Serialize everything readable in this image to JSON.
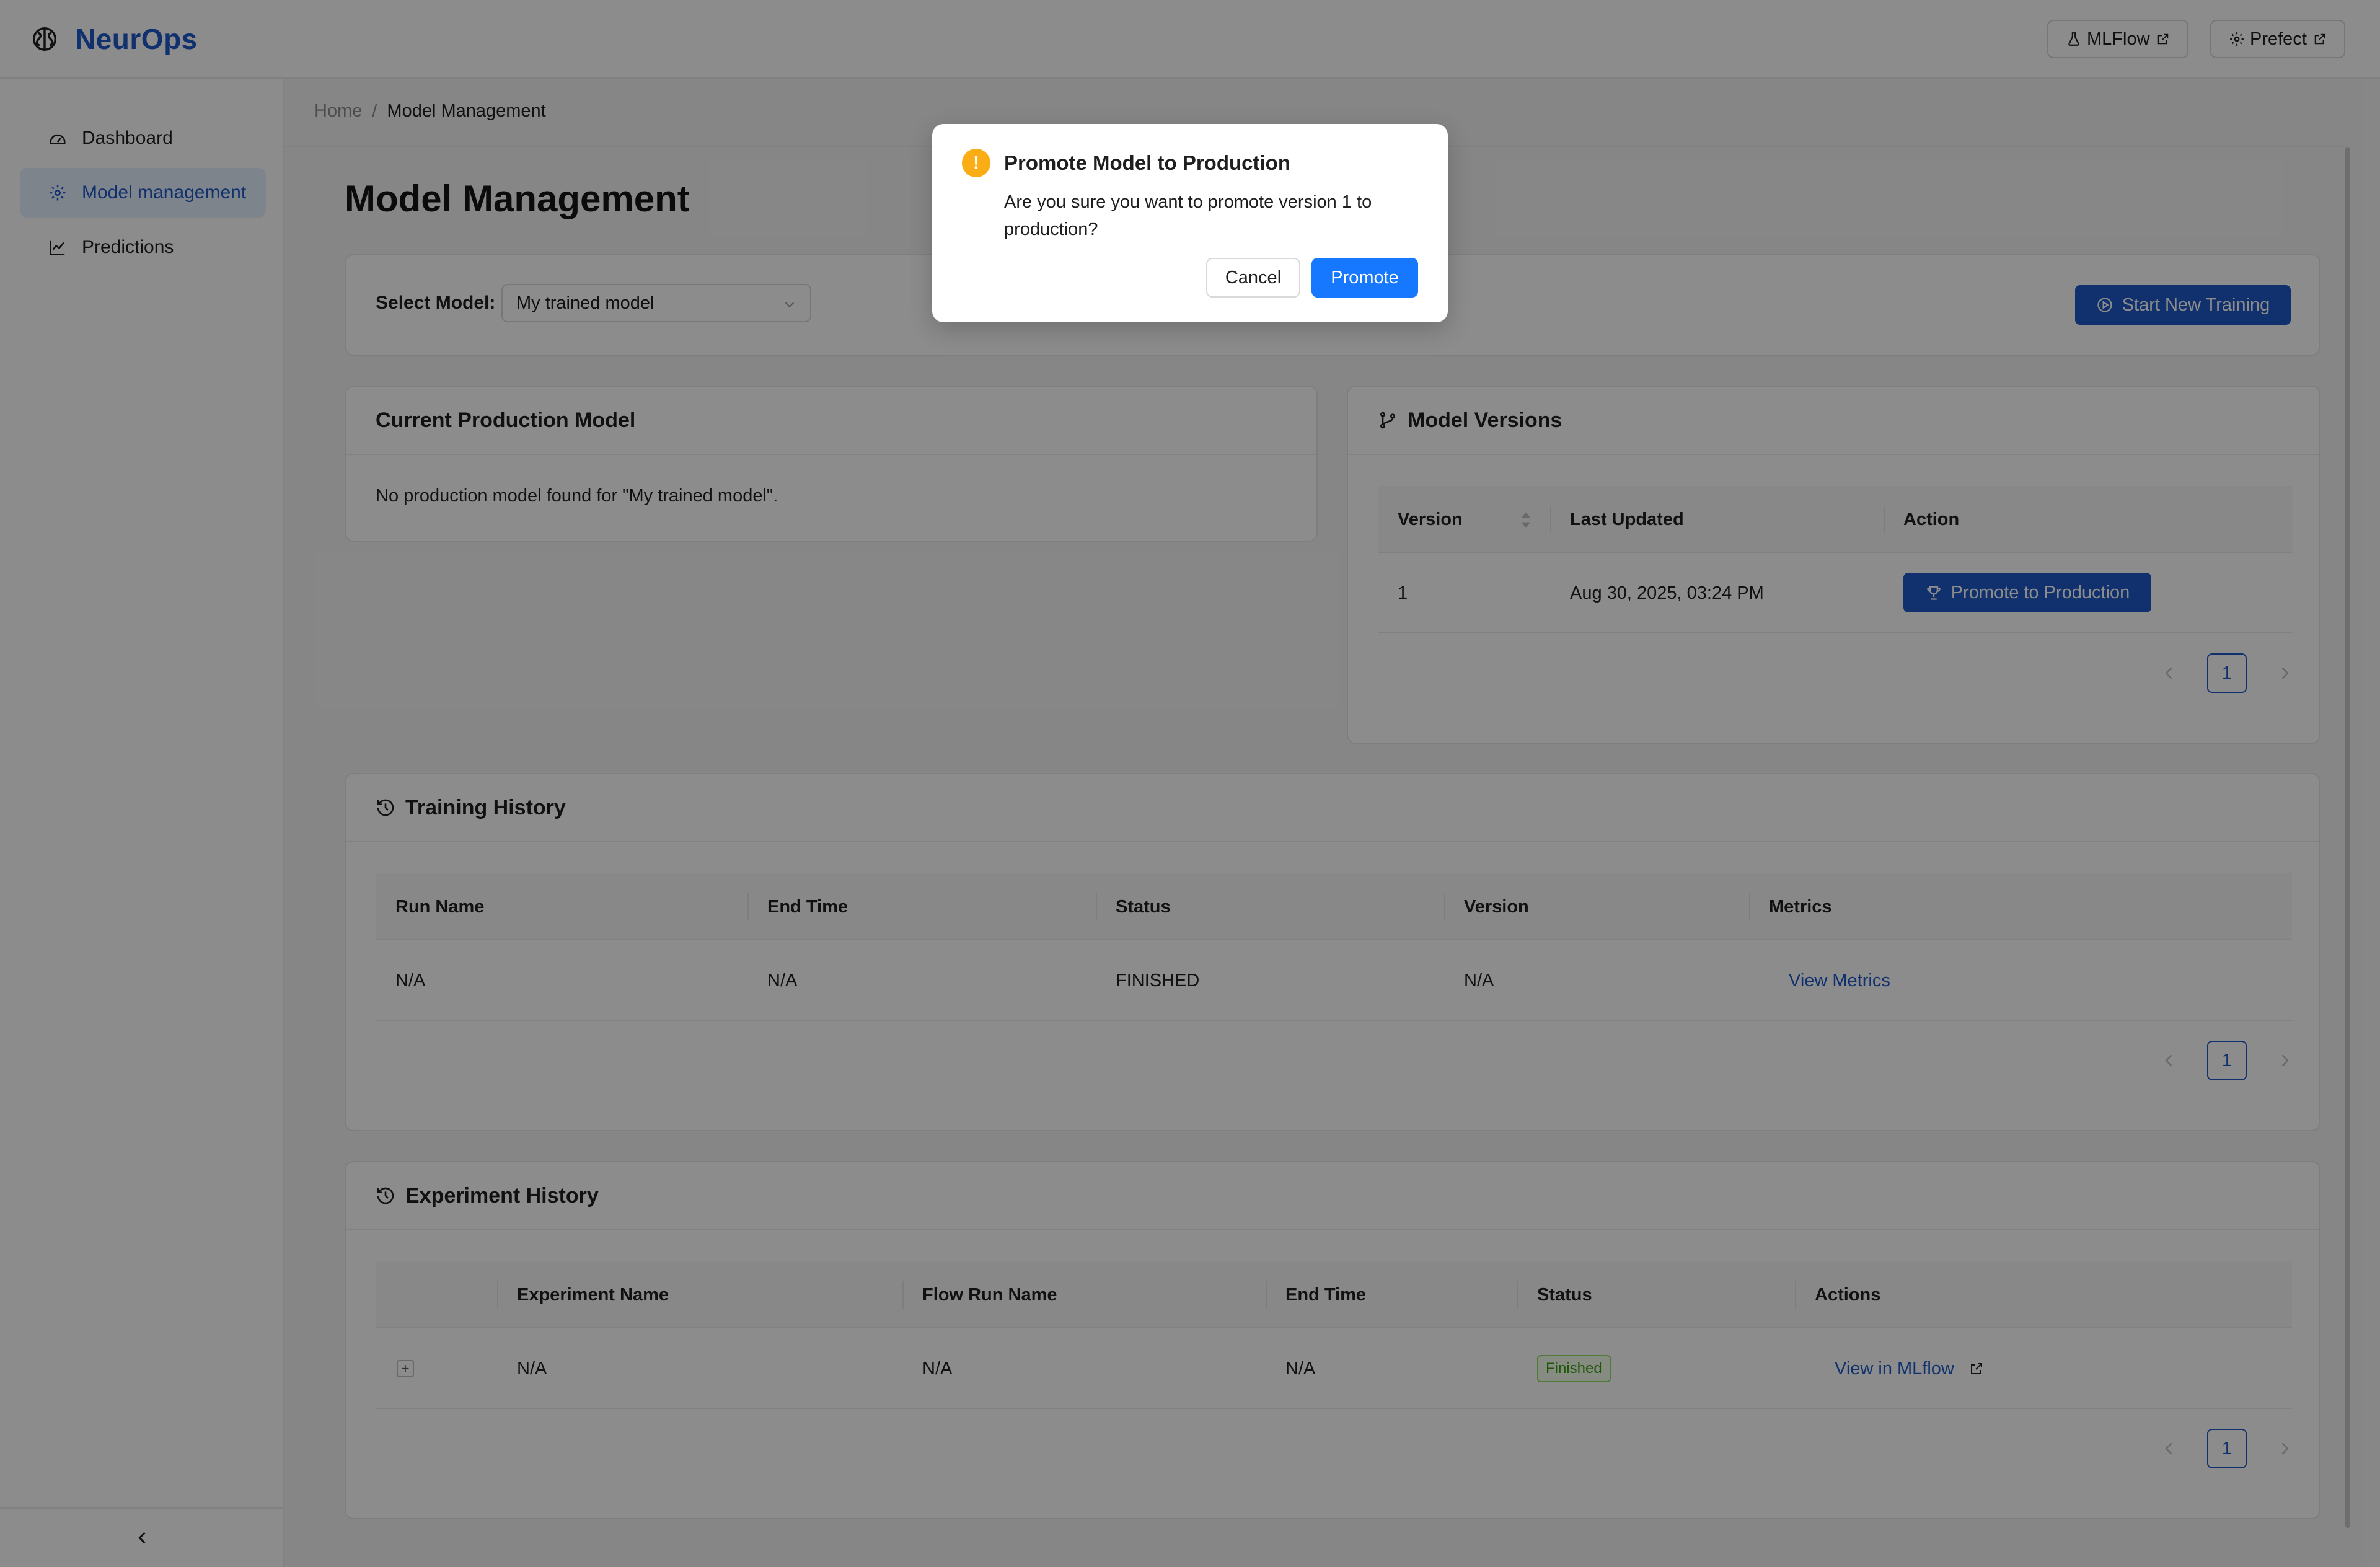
{
  "app": {
    "name": "NeurOps"
  },
  "header": {
    "links": [
      {
        "label": "MLFlow",
        "icon": "flask-icon"
      },
      {
        "label": "Prefect",
        "icon": "gear-icon"
      }
    ]
  },
  "sidebar": {
    "items": [
      {
        "label": "Dashboard",
        "icon": "dashboard-icon",
        "active": false
      },
      {
        "label": "Model management",
        "icon": "gear-icon",
        "active": true
      },
      {
        "label": "Predictions",
        "icon": "line-chart-icon",
        "active": false
      }
    ]
  },
  "breadcrumb": {
    "home": "Home",
    "separator": "/",
    "current": "Model Management"
  },
  "page": {
    "title": "Model Management"
  },
  "toolbar": {
    "select_label": "Select Model:",
    "selected_model": "My trained model",
    "start_training_label": "Start New Training"
  },
  "production": {
    "title": "Current Production Model",
    "empty_message": "No production model found for \"My trained model\"."
  },
  "versions": {
    "title": "Model Versions",
    "columns": [
      "Version",
      "Last Updated",
      "Action"
    ],
    "rows": [
      {
        "version": "1",
        "last_updated": "Aug 30, 2025, 03:24 PM",
        "action": "Promote to Production"
      }
    ],
    "page": "1"
  },
  "training": {
    "title": "Training History",
    "columns": [
      "Run Name",
      "End Time",
      "Status",
      "Version",
      "Metrics"
    ],
    "rows": [
      {
        "run_name": "N/A",
        "end_time": "N/A",
        "status": "FINISHED",
        "version": "N/A",
        "metrics": "View Metrics"
      }
    ],
    "page": "1"
  },
  "experiments": {
    "title": "Experiment History",
    "columns": [
      "Experiment Name",
      "Flow Run Name",
      "End Time",
      "Status",
      "Actions"
    ],
    "rows": [
      {
        "experiment_name": "N/A",
        "flow_run_name": "N/A",
        "end_time": "N/A",
        "status": "Finished",
        "action": "View in MLflow"
      }
    ],
    "page": "1"
  },
  "modal": {
    "icon": "!",
    "title": "Promote Model to Production",
    "body": "Are you sure you want to promote version 1 to production?",
    "cancel": "Cancel",
    "confirm": "Promote"
  },
  "colors": {
    "brand": "#1e5ac8",
    "primary_button": "#1677ff",
    "warning": "#faad14",
    "success": "#389e0d"
  }
}
